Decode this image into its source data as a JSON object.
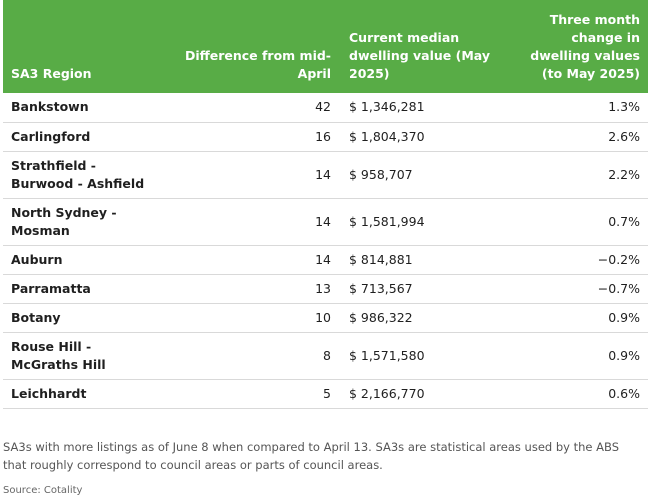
{
  "table": {
    "headers": {
      "region": "SA3 Region",
      "difference": "Difference from mid-April",
      "value": "Current median dwelling value (May 2025)",
      "change": "Three month change in dwelling values (to May 2025)"
    },
    "rows": [
      {
        "region": "Bankstown",
        "difference": "42",
        "value": "$ 1,346,281",
        "change": "1.3%"
      },
      {
        "region": "Carlingford",
        "difference": "16",
        "value": "$ 1,804,370",
        "change": "2.6%"
      },
      {
        "region": "Strathfield - Burwood - Ashfield",
        "difference": "14",
        "value": "$ 958,707",
        "change": "2.2%"
      },
      {
        "region": "North Sydney - Mosman",
        "difference": "14",
        "value": "$ 1,581,994",
        "change": "0.7%"
      },
      {
        "region": "Auburn",
        "difference": "14",
        "value": "$ 814,881",
        "change": "−0.2%"
      },
      {
        "region": "Parramatta",
        "difference": "13",
        "value": "$ 713,567",
        "change": "−0.7%"
      },
      {
        "region": "Botany",
        "difference": "10",
        "value": "$ 986,322",
        "change": "0.9%"
      },
      {
        "region": "Rouse Hill - McGraths Hill",
        "difference": "8",
        "value": "$ 1,571,580",
        "change": "0.9%"
      },
      {
        "region": "Leichhardt",
        "difference": "5",
        "value": "$ 2,166,770",
        "change": "0.6%"
      }
    ]
  },
  "note": "SA3s with more listings as of June 8 when compared to April 13. SA3s are statistical areas used by the ABS that roughly correspond to council areas or parts of council areas.",
  "source": "Source: Cotality",
  "colors": {
    "header_bg": "#58ac46",
    "header_text": "#ffffff",
    "row_divider": "#d9d9d9"
  }
}
